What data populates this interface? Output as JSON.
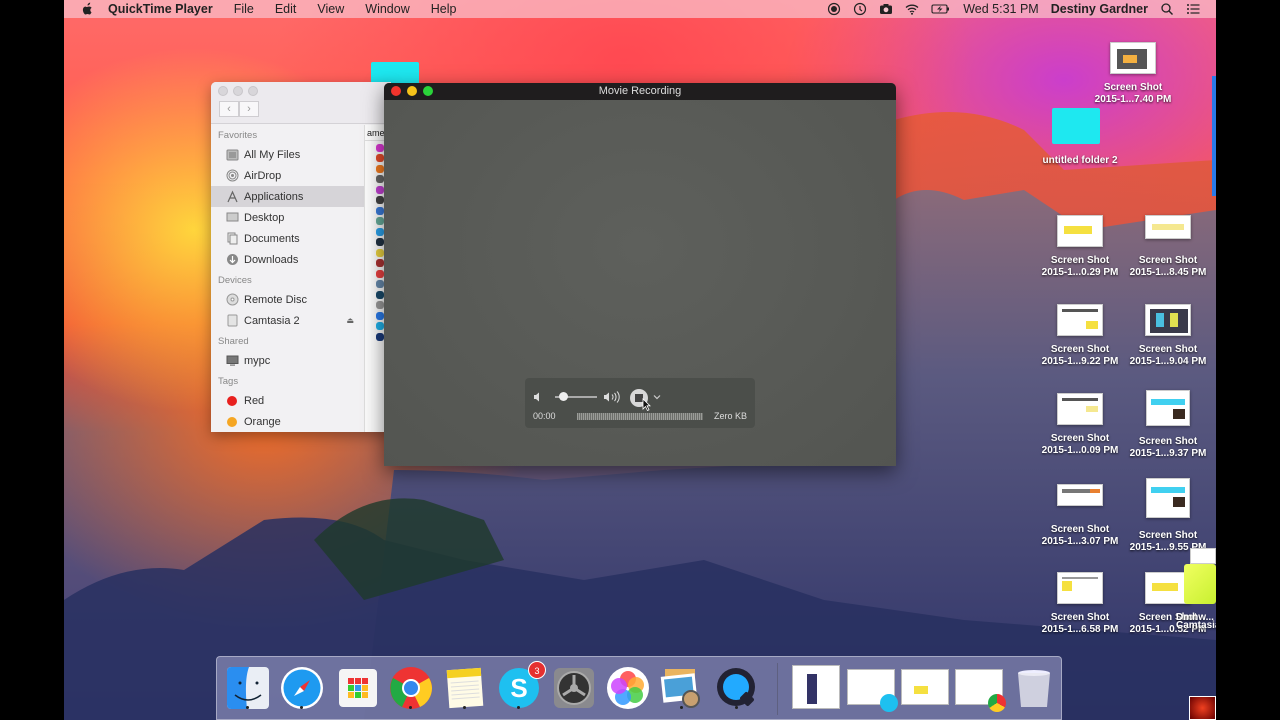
{
  "menubar": {
    "app_name": "QuickTime Player",
    "menus": [
      "File",
      "Edit",
      "View",
      "Window",
      "Help"
    ],
    "status_icons": [
      "record-stop-icon",
      "time-machine-icon",
      "camera-icon",
      "wifi-icon",
      "battery-icon"
    ],
    "clock": "Wed 5:31 PM",
    "user": "Destiny Gardner"
  },
  "finder": {
    "sections": [
      {
        "title": "Favorites",
        "items": [
          {
            "label": "All My Files",
            "icon": "all-files-icon"
          },
          {
            "label": "AirDrop",
            "icon": "airdrop-icon"
          },
          {
            "label": "Applications",
            "icon": "applications-icon",
            "selected": true
          },
          {
            "label": "Desktop",
            "icon": "desktop-icon"
          },
          {
            "label": "Documents",
            "icon": "documents-icon"
          },
          {
            "label": "Downloads",
            "icon": "downloads-icon"
          }
        ]
      },
      {
        "title": "Devices",
        "items": [
          {
            "label": "Remote Disc",
            "icon": "disc-icon"
          },
          {
            "label": "Camtasia 2",
            "icon": "drive-icon",
            "eject": true
          }
        ]
      },
      {
        "title": "Shared",
        "items": [
          {
            "label": "mypc",
            "icon": "computer-icon"
          }
        ]
      },
      {
        "title": "Tags",
        "items": [
          {
            "label": "Red",
            "color": "#e8201e"
          },
          {
            "label": "Orange",
            "color": "#f5a623"
          }
        ]
      }
    ],
    "column_header": "ame"
  },
  "movie_window": {
    "title": "Movie Recording",
    "elapsed": "00:00",
    "file_size": "Zero KB",
    "volume_level": 0.1
  },
  "desktop_icons": [
    {
      "line1": "Screen Shot",
      "line2": "2015-1...7.40 PM"
    },
    {
      "line1": "untitled folder 2",
      "line2": ""
    },
    {
      "line1": "Screen Shot",
      "line2": "2015-1...0.29 PM"
    },
    {
      "line1": "Screen Shot",
      "line2": "2015-1...8.45 PM"
    },
    {
      "line1": "Screen Shot",
      "line2": "2015-1...9.22 PM"
    },
    {
      "line1": "Screen Shot",
      "line2": "2015-1...9.04 PM"
    },
    {
      "line1": "Screen Shot",
      "line2": "2015-1...0.09 PM"
    },
    {
      "line1": "Screen Shot",
      "line2": "2015-1...9.37 PM"
    },
    {
      "line1": "Screen Shot",
      "line2": "2015-1...3.07 PM"
    },
    {
      "line1": "Screen Shot",
      "line2": "2015-1...9.55 PM"
    },
    {
      "line1": "Screen Shot",
      "line2": "2015-1...6.58 PM"
    },
    {
      "line1": "Screen Shot",
      "line2": "2015-1...0.52 PM"
    },
    {
      "line1": "Dmhw...",
      "line2": "Camtasia"
    }
  ],
  "dock": {
    "apps": [
      "Finder",
      "Safari",
      "Launchpad",
      "Google Chrome",
      "Notes",
      "Skype",
      "System Preferences",
      "Photos",
      "Preview",
      "QuickTime Player"
    ],
    "skype_badge": "3",
    "minimized_windows": 4,
    "trash": "Trash"
  }
}
